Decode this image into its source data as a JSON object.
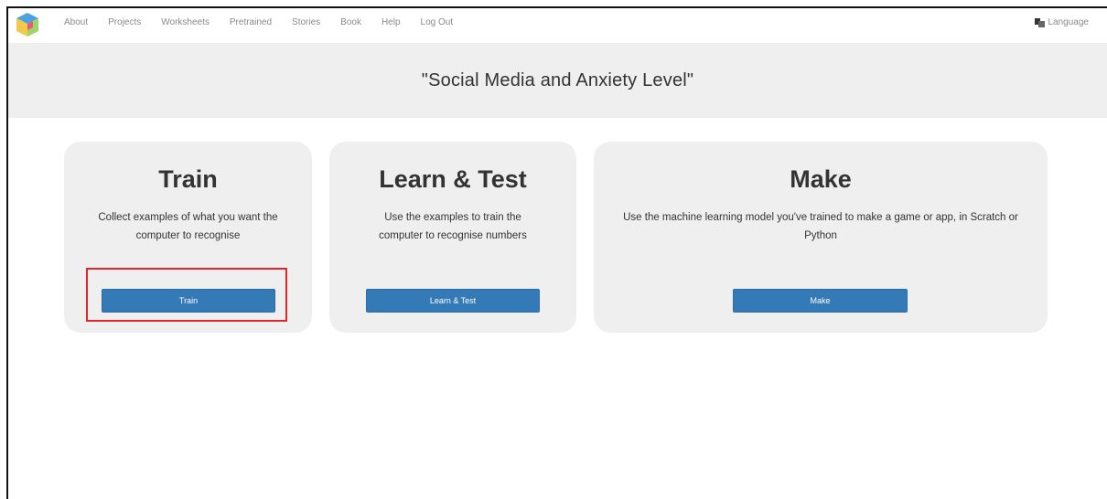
{
  "nav": {
    "items": [
      {
        "label": "About"
      },
      {
        "label": "Projects"
      },
      {
        "label": "Worksheets"
      },
      {
        "label": "Pretrained"
      },
      {
        "label": "Stories"
      },
      {
        "label": "Book"
      },
      {
        "label": "Help"
      },
      {
        "label": "Log Out"
      }
    ],
    "language_label": "Language"
  },
  "project": {
    "title": "\"Social Media and Anxiety Level\""
  },
  "cards": [
    {
      "heading": "Train",
      "description": "Collect examples of what you want the computer to recognise",
      "button_label": "Train"
    },
    {
      "heading": "Learn & Test",
      "description": "Use the examples to train the computer to recognise numbers",
      "button_label": "Learn & Test"
    },
    {
      "heading": "Make",
      "description": "Use the machine learning model you've trained to make a game or app, in Scratch or Python",
      "button_label": "Make"
    }
  ],
  "colors": {
    "button": "#337ab7",
    "card_bg": "#efefef",
    "highlight": "#e0252b"
  }
}
